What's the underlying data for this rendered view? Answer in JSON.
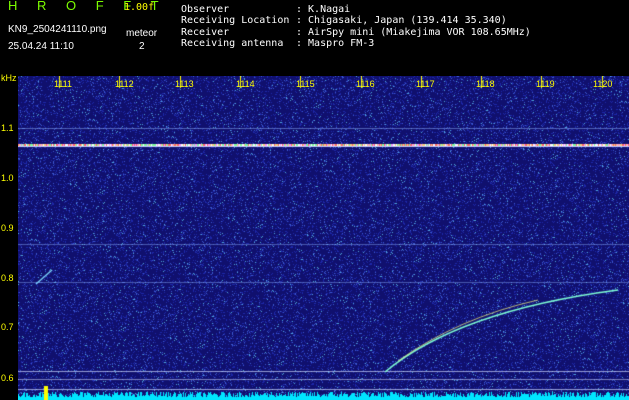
{
  "header": {
    "app_title": "H R O F F T",
    "version": "1.00f",
    "filename": "KN9_2504241110.png",
    "mode": "meteor",
    "datetime": "25.04.24 11:10",
    "count": "2"
  },
  "info": {
    "observer_label": "Observer",
    "observer_value": ": K.Nagai",
    "location_label": "Receiving Location",
    "location_value": ": Chigasaki, Japan (139.414 35.340)",
    "receiver_label": "Receiver",
    "receiver_value": ": AirSpy mini (Miakejima VOR 108.65MHz)",
    "antenna_label": "Receiving antenna",
    "antenna_value": ": Maspro FM-3"
  },
  "axes": {
    "y_unit": "kHz",
    "y_ticks": [
      "1.1",
      "1.0",
      "0.9",
      "0.8",
      "0.7",
      "0.6"
    ],
    "x_ticks": [
      "1111",
      "1112",
      "1113",
      "1114",
      "1115",
      "1116",
      "1117",
      "1118",
      "1119",
      "1120"
    ]
  },
  "colors": {
    "background": "#10106e",
    "label": "#ffff00",
    "title": "#7cfc00",
    "signal": "#7fffd4"
  }
}
